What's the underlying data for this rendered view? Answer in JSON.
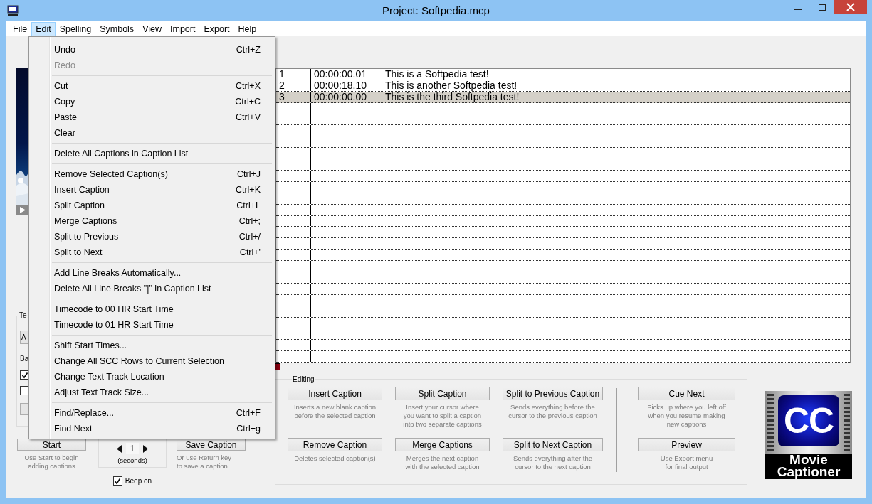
{
  "window": {
    "title": "Project: Softpedia.mcp"
  },
  "menu_bar": [
    {
      "label": "File",
      "selected": false
    },
    {
      "label": "Edit",
      "selected": true
    },
    {
      "label": "Spelling",
      "selected": false
    },
    {
      "label": "Symbols",
      "selected": false
    },
    {
      "label": "View",
      "selected": false
    },
    {
      "label": "Import",
      "selected": false
    },
    {
      "label": "Export",
      "selected": false
    },
    {
      "label": "Help",
      "selected": false
    }
  ],
  "edit_menu": {
    "groups": [
      [
        {
          "label": "Undo",
          "shortcut": "Ctrl+Z",
          "disabled": false
        },
        {
          "label": "Redo",
          "disabled": true
        }
      ],
      [
        {
          "label": "Cut",
          "shortcut": "Ctrl+X",
          "disabled": false
        },
        {
          "label": "Copy",
          "shortcut": "Ctrl+C",
          "disabled": false
        },
        {
          "label": "Paste",
          "shortcut": "Ctrl+V",
          "disabled": false
        },
        {
          "label": "Clear",
          "disabled": false
        }
      ],
      [
        {
          "label": "Delete All Captions in Caption List",
          "disabled": false
        }
      ],
      [
        {
          "label": "Remove Selected Caption(s)",
          "shortcut": "Ctrl+J",
          "disabled": false
        },
        {
          "label": "Insert Caption",
          "shortcut": "Ctrl+K",
          "disabled": false
        },
        {
          "label": "Split Caption",
          "shortcut": "Ctrl+L",
          "disabled": false
        },
        {
          "label": "Merge Captions",
          "shortcut": "Ctrl+;",
          "disabled": false
        },
        {
          "label": "Split to Previous",
          "shortcut": "Ctrl+/",
          "disabled": false
        },
        {
          "label": "Split to Next",
          "shortcut": "Ctrl+'",
          "disabled": false
        }
      ],
      [
        {
          "label": "Add Line Breaks Automatically...",
          "disabled": false
        },
        {
          "label": "Delete All Line Breaks \"|\" in Caption List",
          "disabled": false
        }
      ],
      [
        {
          "label": "Timecode to 00 HR Start Time",
          "disabled": false
        },
        {
          "label": "Timecode to 01 HR Start Time",
          "disabled": false
        }
      ],
      [
        {
          "label": "Shift Start Times...",
          "disabled": false
        },
        {
          "label": "Change All SCC Rows to Current Selection",
          "disabled": false
        },
        {
          "label": "Change Text Track Location",
          "disabled": false
        },
        {
          "label": "Adjust Text Track Size...",
          "disabled": false
        }
      ],
      [
        {
          "label": "Find/Replace...",
          "shortcut": "Ctrl+F",
          "disabled": false
        },
        {
          "label": "Find Next",
          "shortcut": "Ctrl+g",
          "disabled": false
        }
      ]
    ]
  },
  "left_panel": {
    "group_label": "Te",
    "combo_value": "A",
    "label": "Ba",
    "checkboxes": [
      {
        "checked": true
      },
      {
        "checked": false
      }
    ]
  },
  "start": {
    "button": "Start",
    "hint_lines": [
      "Use Start to begin",
      "adding captions"
    ]
  },
  "delay": {
    "value": "1",
    "unit": "(seconds)"
  },
  "beep": {
    "label": "Beep on",
    "checked": true
  },
  "save": {
    "button": "Save Caption",
    "hint_lines": [
      "Or use Return key",
      "to save a caption"
    ]
  },
  "captions": {
    "rows": [
      {
        "cells": [
          "1",
          "00:00:00.01",
          "This is a Softpedia test!"
        ],
        "selected": false
      },
      {
        "cells": [
          "2",
          "00:00:18.10",
          "This is another Softpedia test!"
        ],
        "selected": false
      },
      {
        "cells": [
          "3",
          "00:00:00.00",
          "This is the third Softpedia test!"
        ],
        "selected": true
      }
    ]
  },
  "editing": {
    "title": "Editing",
    "columns": [
      [
        {
          "button": "Insert Caption",
          "hint_lines": [
            "Inserts a new blank caption",
            "before the selected caption"
          ]
        },
        {
          "button": "Remove Caption",
          "hint_lines": [
            "Deletes selected caption(s)"
          ]
        }
      ],
      [
        {
          "button": "Split Caption",
          "hint_lines": [
            "Insert your cursor where",
            "you want to split a caption",
            "into two separate captions"
          ]
        },
        {
          "button": "Merge Captions",
          "hint_lines": [
            "Merges the next caption",
            "with the selected caption"
          ]
        }
      ],
      [
        {
          "button": "Split to Previous Caption",
          "hint_lines": [
            "Sends everything before the",
            "cursor to the previous caption"
          ]
        },
        {
          "button": "Split to Next Caption",
          "hint_lines": [
            "Sends everything after the",
            "cursor to the next caption"
          ]
        }
      ],
      [
        {
          "button": "Cue Next",
          "hint_lines": [
            "Picks up where you left off",
            "when you resume making",
            "new captions"
          ]
        },
        {
          "button": "Preview",
          "hint_lines": [
            "Use Export menu",
            "for final output"
          ]
        }
      ]
    ]
  },
  "logo": {
    "badge": "CC",
    "name_lines": [
      "Movie",
      "Captioner"
    ]
  }
}
